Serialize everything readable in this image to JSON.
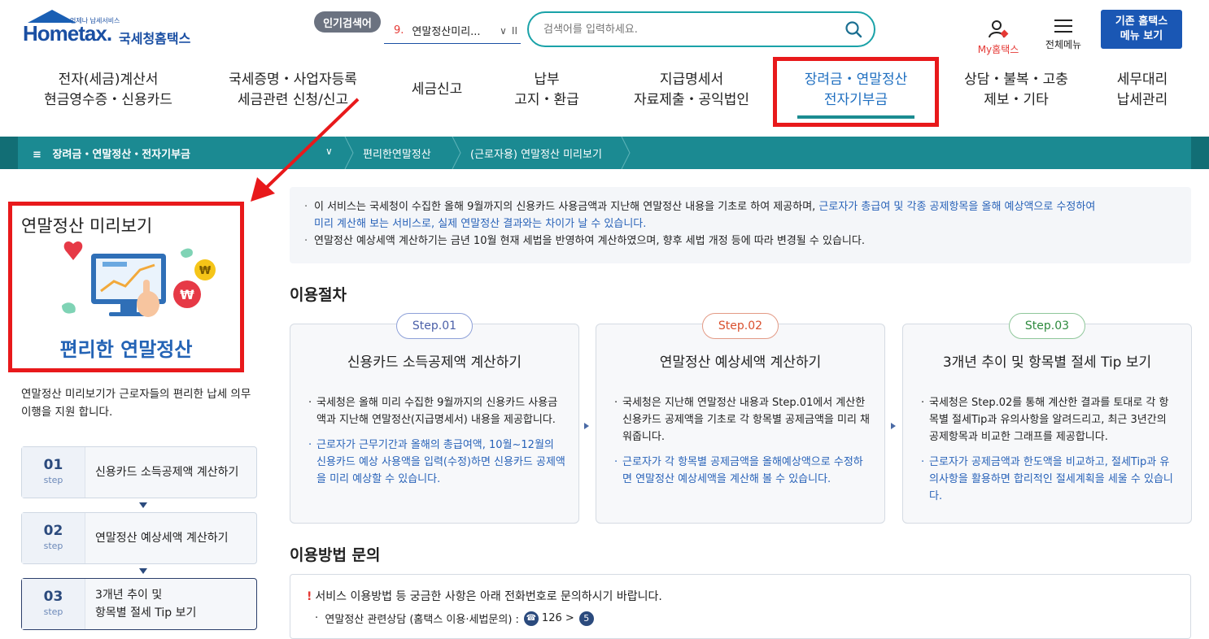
{
  "header": {
    "logo_text": "Hometax.",
    "logo_kr": "국세청홈택스",
    "logo_small": "언제나 납세서비스",
    "popular_badge": "인기검색어",
    "popular_num": "9.",
    "popular_term": "연말정산미리...",
    "search_placeholder": "검색어를 입력하세요.",
    "my_home": "My홈택스",
    "all_menu": "전체메뉴",
    "old_home_line1": "기존 홈택스",
    "old_home_line2": "메뉴 보기"
  },
  "nav": [
    {
      "line1": "전자(세금)계산서",
      "line2": "현금영수증・신용카드"
    },
    {
      "line1": "국세증명・사업자등록",
      "line2": "세금관련 신청/신고"
    },
    {
      "line1": "세금신고",
      "line2": ""
    },
    {
      "line1": "납부",
      "line2": "고지・환급"
    },
    {
      "line1": "지급명세서",
      "line2": "자료제출・공익법인"
    },
    {
      "line1": "장려금・연말정산",
      "line2": "전자기부금"
    },
    {
      "line1": "상담・불복・고충",
      "line2": "제보・기타"
    },
    {
      "line1": "세무대리",
      "line2": "납세관리"
    }
  ],
  "breadcrumb": {
    "menu": "장려금・연말정산・전자기부금",
    "item1": "편리한연말정산",
    "item2": "(근로자용) 연말정산 미리보기"
  },
  "sidebar": {
    "title": "연말정산 미리보기",
    "subtitle": "편리한 연말정산",
    "desc": "연말정산 미리보기가 근로자들의  편리한 납세 의무 이행을 지원 합니다.",
    "steps": [
      {
        "num": "01",
        "label": "step",
        "text1": "신용카드 소득공제액 계산하기",
        "text2": ""
      },
      {
        "num": "02",
        "label": "step",
        "text1": "연말정산 예상세액 계산하기",
        "text2": ""
      },
      {
        "num": "03",
        "label": "step",
        "text1": "3개년 추이 및",
        "text2": "항목별 절세 Tip 보기"
      }
    ]
  },
  "notice": {
    "l1a": "이 서비스는 국세청이 수집한 올해 9월까지의 신용카드 사용금액과 지난해 연말정산 내용을 기초로 하여 제공하며, ",
    "l1b": "근로자가 총급여 및 각종 공제항목을 올해 예상액으로 수정하여",
    "l1c": "미리 계산해 보는 서비스로, 실제 연말정산 결과와는 차이가 날 수 있습니다.",
    "l2": "연말정산 예상세액 계산하기는 금년 10월 현재 세법을 반영하여 계산하였으며, 향후 세법 개정 등에 따라 변경될 수 있습니다."
  },
  "procedure": {
    "title": "이용절차",
    "steps": [
      {
        "pill": "Step.01",
        "title": "신용카드 소득공제액 계산하기",
        "p1": "국세청은 올해 미리 수집한 9월까지의 신용카드 사용금액과 지난해 연말정산(지급명세서) 내용을 제공합니다.",
        "p2": "근로자가 근무기간과 올해의 총급여액, 10월~12월의 신용카드 예상 사용액을 입력(수정)하면 신용카드 공제액을 미리 예상할 수 있습니다."
      },
      {
        "pill": "Step.02",
        "title": "연말정산 예상세액 계산하기",
        "p1": "국세청은 지난해 연말정산 내용과 Step.01에서 계산한 신용카드 공제액을 기초로 각 항목별 공제금액을 미리 채워줍니다.",
        "p2": "근로자가 각 항목별 공제금액을 올해예상액으로 수정하면 연말정산 예상세액을 계산해 볼 수 있습니다."
      },
      {
        "pill": "Step.03",
        "title": "3개년 추이 및 항목별 절세 Tip 보기",
        "p1": "국세청은 Step.02를 통해 계산한 결과를 토대로 각 항목별 절세Tip과 유의사항을 알려드리고, 최근 3년간의 공제항목과 비교한 그래프를 제공합니다.",
        "p2": "근로자가 공제금액과 한도액을 비교하고, 절세Tip과 유의사항을 활용하면 합리적인 절세계획을 세울 수 있습니다."
      }
    ]
  },
  "inquiry": {
    "title": "이용방법 문의",
    "mark": "!",
    "text": "서비스 이용방법 등 궁금한 사항은 아래 전화번호로 문의하시기 바랍니다.",
    "sub": "연말정산 관련상담 (홈택스 이용·세법문의) :",
    "phone": "126",
    "arrow": ">",
    "option": "5"
  },
  "colors": {
    "accent": "#1b8a92",
    "highlight": "#e8191b",
    "blue_text": "#2862b8",
    "step1": "#5b6fb5",
    "step2": "#d9502e",
    "step3": "#2e8a3e"
  }
}
